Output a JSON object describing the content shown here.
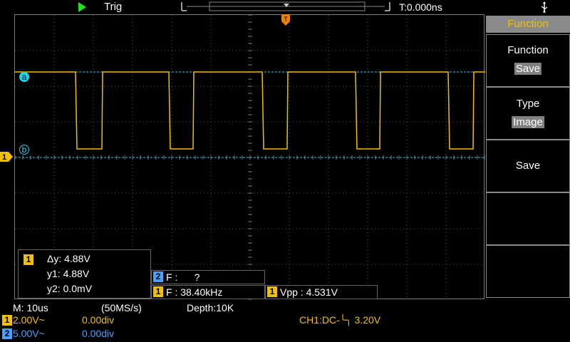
{
  "top": {
    "run_state": "Trig",
    "timebase_offset": "T:0.000ns"
  },
  "colors": {
    "ch1": "#f0c000",
    "ch2": "#4aa0ff",
    "cursor": "#20d0e8",
    "menu_header_text": "#f0c000"
  },
  "cursors": {
    "a_label": "a",
    "b_label": "b",
    "channel": "1",
    "delta_y": "Δy: 4.88V",
    "y1": "y1: 4.88V",
    "y2": "y2: 0.0mV"
  },
  "measurements": {
    "f2": {
      "channel": "2",
      "text": "F :      ?"
    },
    "f1": {
      "channel": "1",
      "text": "F : 38.40kHz"
    },
    "vpp": {
      "channel": "1",
      "text": "Vpp : 4.531V"
    }
  },
  "menu": {
    "header": "Function",
    "items": [
      {
        "title": "Function",
        "value": "Save"
      },
      {
        "title": "Type",
        "value": "Image"
      },
      {
        "title": "Save",
        "value": ""
      }
    ]
  },
  "status": {
    "mode": "M: 10us",
    "sample_rate": "(50MS/s)",
    "depth": "Depth:10K",
    "ch1": {
      "badge": "1",
      "scale": "2.00V~",
      "position": "0.00div"
    },
    "ch2": {
      "badge": "2",
      "scale": "5.00V~",
      "position": "0.00div"
    },
    "trigger": "CH1:DC-╰╮ 3.20V"
  }
}
